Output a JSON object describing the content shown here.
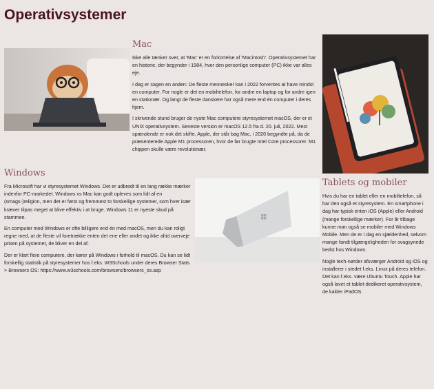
{
  "page": {
    "title": "Operativsystemer"
  },
  "mac": {
    "heading": "Mac",
    "paragraphs": [
      "Ikke alle tænker over, at 'Mac' er en forkortelse af 'Macintosh'. Operativsystemet har en historie, der begynder i 1984, hvor den personlige computer (PC) ikke var alles eje.",
      "I dag er sagen en anden: De fleste mennesker kan i 2022 forventes at have mindst en computer. For nogle er det en mobiltelefon, for andre en laptop og for andre igen en stationær. Og langt de fleste danskere har også mere end én computer i deres hjem.",
      "I skrivende stund bruger de nyste Mac computere styresystemet macOS, der er et UNIX operativsystem. Seneste version er macOS 12.5 fra d. 20. juli, 2022. Mest spændende er nok det skifte, Apple, der står bag Mac, i 2020 begyndte på, da de præsenterede Apple M1 processoren, hvor de før brugte Intel Core processorer. M1 chippen skulle være revolutionær."
    ]
  },
  "windows": {
    "heading": "Windows",
    "paragraphs": [
      "Fra Microsoft har vi styresystemet Windows. Det er udbredt til en lang række mærker indenfor PC-markedet. Windows vs Mac kan godt opleves som lidt af en (smags-)religion, men det er først og fremmest to forskellige systemer, som hver især kræver tilpas meget at blive effektiv i at bruge. Windows 11 er nyeste skud på stammen.",
      "En computer med Windows er ofte billigere end én med macOS, men du kan roligt regne med, at de fleste vil foretrække enten det ene eller andet og ikke altid overveje prisen på systemet, de bliver en del af.",
      "Der er klart flere computere, der kører på Windows i forhold til macOS. Du kan se lidt forskellig statistik på styresystemer hos f.eks. W3Schools under deres Browser Stats > Browsers OS: https://www.w3schools.com/browsers/browsers_os.asp"
    ]
  },
  "tablets": {
    "heading": "Tablets og mobiler",
    "paragraphs": [
      "Hvis du har en tablet eller en mobiltelefon, så har den også et styresystem. En smartphone i dag har typisk enten iOS (Apple) eller Android (mange forskellige mærker). For år tilbage kunne man også se mobiler med Windows Mobile. Men de er i dag en sjældenhed, selvom mange fandt tilgængeligheden for svagsynede bedst hos Windows.",
      "Nogle tech-nørder afsværger Android og iOS og installerer i stedet f.eks. Linux på deres telefon. Det kan f.eks. være Ubuntu Touch. Apple har også lavet et tablet-dedikeret operativsystem, de kalder iPadOS."
    ]
  }
}
